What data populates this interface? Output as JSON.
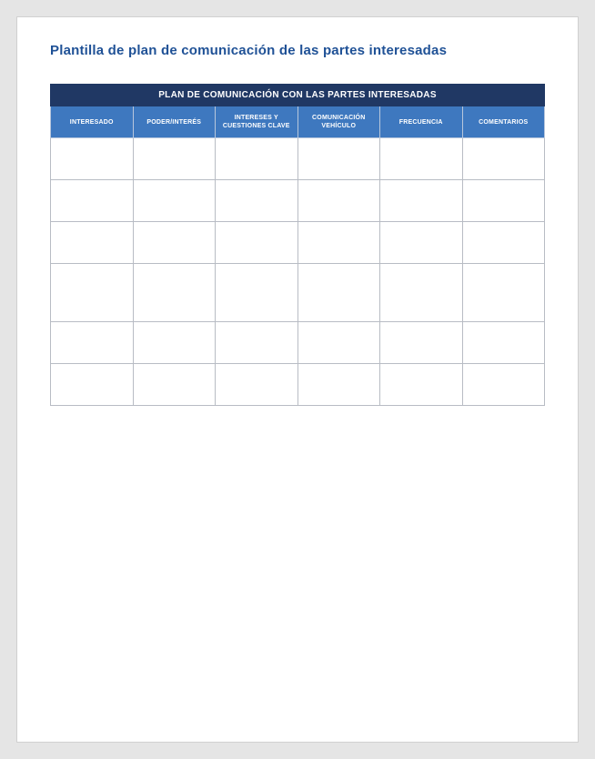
{
  "doc": {
    "title": "Plantilla de plan de comunicación de las partes interesadas"
  },
  "table": {
    "caption": "PLAN DE COMUNICACIÓN CON LAS PARTES INTERESADAS",
    "columns": [
      "INTERESADO",
      "PODER/INTERÉS",
      "INTERESES Y CUESTIONES CLAVE",
      "COMUNICACIÓN VEHÍCULO",
      "FRECUENCIA",
      "COMENTARIOS"
    ],
    "rows": [
      [
        "",
        "",
        "",
        "",
        "",
        ""
      ],
      [
        "",
        "",
        "",
        "",
        "",
        ""
      ],
      [
        "",
        "",
        "",
        "",
        "",
        ""
      ],
      [
        "",
        "",
        "",
        "",
        "",
        ""
      ],
      [
        "",
        "",
        "",
        "",
        "",
        ""
      ],
      [
        "",
        "",
        "",
        "",
        "",
        ""
      ]
    ]
  }
}
